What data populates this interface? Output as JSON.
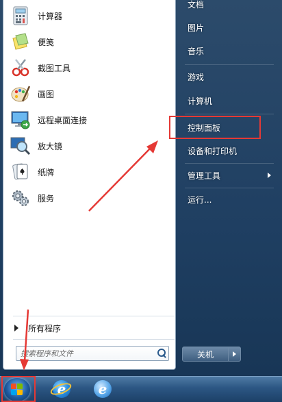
{
  "programs": [
    {
      "label": "计算器",
      "icon": "calculator-icon"
    },
    {
      "label": "便笺",
      "icon": "sticky-notes-icon"
    },
    {
      "label": "截图工具",
      "icon": "snipping-tool-icon"
    },
    {
      "label": "画图",
      "icon": "paint-icon"
    },
    {
      "label": "远程桌面连接",
      "icon": "remote-desktop-icon"
    },
    {
      "label": "放大镜",
      "icon": "magnifier-icon"
    },
    {
      "label": "纸牌",
      "icon": "solitaire-icon"
    },
    {
      "label": "服务",
      "icon": "services-icon"
    }
  ],
  "all_programs_label": "所有程序",
  "search": {
    "placeholder": "搜索程序和文件",
    "value": ""
  },
  "right_items": [
    {
      "label": "文档"
    },
    {
      "label": "图片"
    },
    {
      "label": "音乐"
    },
    {
      "label": "游戏"
    },
    {
      "label": "计算机"
    },
    {
      "label": "控制面板"
    },
    {
      "label": "设备和打印机"
    },
    {
      "label": "管理工具"
    },
    {
      "label": "运行..."
    }
  ],
  "shutdown_label": "关机",
  "taskbar": {
    "items": [
      "start-orb",
      "internet-explorer-icon",
      "internet-explorer-icon"
    ]
  },
  "colors": {
    "highlight": "#e53935",
    "menu_bg": "#1f3f62",
    "taskbar": "#2c5683"
  }
}
